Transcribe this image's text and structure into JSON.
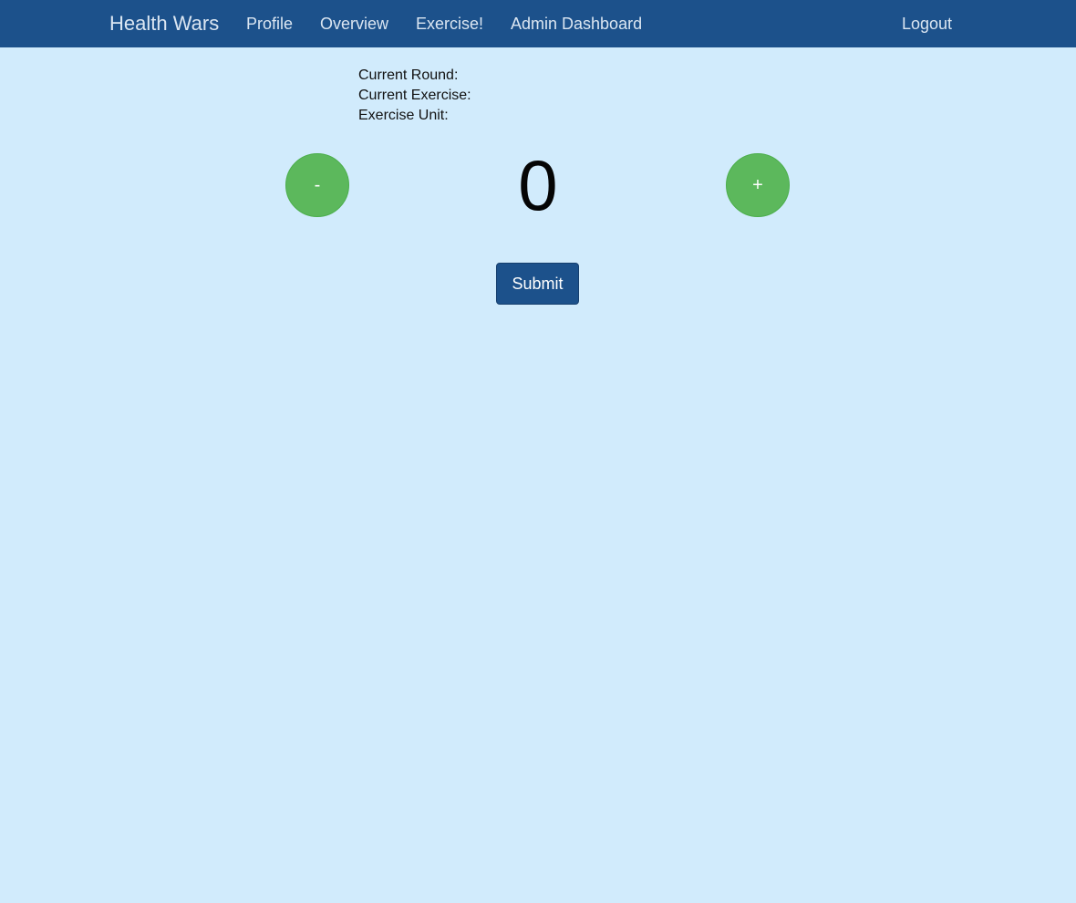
{
  "navbar": {
    "brand": "Health Wars",
    "links": {
      "profile": "Profile",
      "overview": "Overview",
      "exercise": "Exercise!",
      "admin": "Admin Dashboard"
    },
    "logout": "Logout",
    "background_color": "#1c518b"
  },
  "info": {
    "current_round_label": "Current Round:",
    "current_exercise_label": "Current Exercise:",
    "exercise_unit_label": "Exercise Unit:"
  },
  "counter": {
    "decrement_label": "-",
    "value": "0",
    "increment_label": "+",
    "button_color": "#5cb85c"
  },
  "submit_label": "Submit",
  "page_background": "#d1ebfc"
}
